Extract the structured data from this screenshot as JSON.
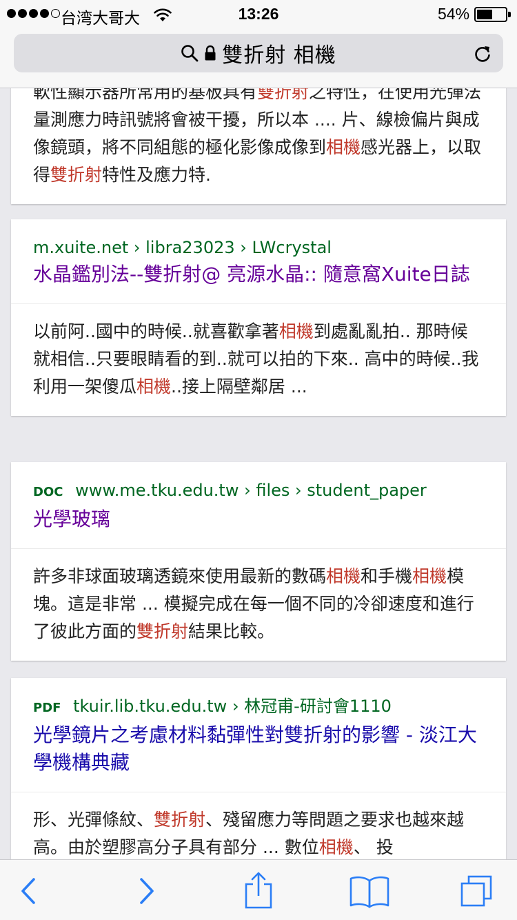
{
  "status_bar": {
    "carrier": "台湾大哥大",
    "time": "13:26",
    "battery_percent": "54%",
    "battery_level": 0.54,
    "signal_bars_filled": 4,
    "signal_bars_total": 5
  },
  "address_bar": {
    "query": "雙折射 相機"
  },
  "results": [
    {
      "snippet_parts": [
        {
          "t": "軟性顯示器所常用的基板具有"
        },
        {
          "t": "雙折射",
          "hl": true
        },
        {
          "t": "之特性，在使用光彈法量測應力時訊號將會被干擾，所以本 .... 片、線檢偏片與成像鏡頭，將不同組態的極化影像成像到"
        },
        {
          "t": "相機",
          "hl": true
        },
        {
          "t": "感光器上，以取得"
        },
        {
          "t": "雙折射",
          "hl": true
        },
        {
          "t": "特性及應力特."
        }
      ]
    },
    {
      "file_type": "",
      "url": "m.xuite.net › libra23023 › LWcrystal",
      "title": "水晶鑑別法--雙折射@ 亮源水晶:: 隨意窩Xuite日誌",
      "visited": true,
      "snippet_parts": [
        {
          "t": "以前阿..國中的時候..就喜歡拿著"
        },
        {
          "t": "相機",
          "hl": true
        },
        {
          "t": "到處亂亂拍.. 那時候就相信..只要眼睛看的到..就可以拍的下來.. 高中的時候..我利用一架傻瓜"
        },
        {
          "t": "相機",
          "hl": true
        },
        {
          "t": "..接上隔壁鄰居 ..."
        }
      ]
    },
    {
      "file_type": "DOC",
      "url": "www.me.tku.edu.tw › files › student_paper",
      "title": "光學玻璃",
      "visited": true,
      "snippet_parts": [
        {
          "t": "許多非球面玻璃透鏡來使用最新的數碼"
        },
        {
          "t": "相機",
          "hl": true
        },
        {
          "t": "和手機"
        },
        {
          "t": "相機",
          "hl": true
        },
        {
          "t": "模塊。這是非常 ... 模擬完成在每一個不同的冷卻速度和進行了彼此方面的"
        },
        {
          "t": "雙折射",
          "hl": true
        },
        {
          "t": "結果比較。"
        }
      ]
    },
    {
      "file_type": "PDF",
      "url": "tkuir.lib.tku.edu.tw › 林冠甫-研討會1110",
      "title": "光學鏡片之考慮材料黏彈性對雙折射的影響 - 淡江大學機構典藏",
      "visited": false,
      "snippet_parts": [
        {
          "t": "形、光彈條紋、"
        },
        {
          "t": "雙折射",
          "hl": true
        },
        {
          "t": "、殘留應力等問題之要求也越來越高。由於塑膠高分子具有部分 ... 數位"
        },
        {
          "t": "相機",
          "hl": true
        },
        {
          "t": "、 投"
        }
      ]
    }
  ],
  "toolbar": {
    "back_icon": "chevron-left-icon",
    "forward_icon": "chevron-right-icon",
    "share_icon": "share-icon",
    "bookmarks_icon": "bookmarks-icon",
    "tabs_icon": "tabs-icon",
    "accent": "#2b7ef6",
    "disabled_color": "#b0b0b5"
  },
  "colors": {
    "url_green": "#006621",
    "visited_purple": "#660099",
    "link_blue": "#1a0dab",
    "highlight_red": "#c0392b"
  }
}
